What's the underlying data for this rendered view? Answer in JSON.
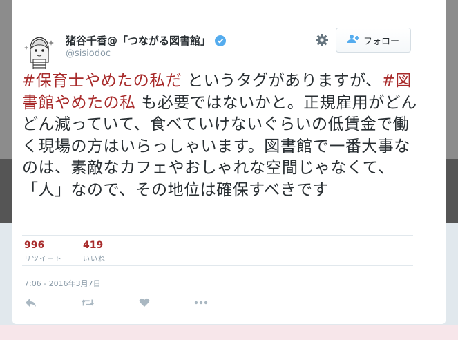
{
  "profile": {
    "display_name": "猪谷千香@「つながる図書館」",
    "handle": "@sisiodoc",
    "verified": true,
    "avatar_icon": "illustrated-avatar"
  },
  "header": {
    "follow_label": "フォロー",
    "follow_icon": "add-user-icon",
    "settings_icon": "gear-icon"
  },
  "tweet": {
    "segments": [
      {
        "text": "#保育士やめたの私だ",
        "hashtag": true
      },
      {
        "text": " というタグがありますが、",
        "hashtag": false
      },
      {
        "text": "#図書館やめたの私",
        "hashtag": true
      },
      {
        "text": " も必要ではないかと。正規雇用がどんどん減っていて、食べていけないぐらいの低賃金で働く現場の方はいらっしゃいます。図書館で一番大事なのは、素敵なカフェやおしゃれな空間じゃなくて、「人」なので、その地位は確保すべきです",
        "hashtag": false
      }
    ]
  },
  "stats": {
    "retweets_count": "996",
    "retweets_label": "リツイート",
    "likes_count": "419",
    "likes_label": "いいね"
  },
  "timestamp": "7:06 - 2016年3月7日",
  "actions": [
    "reply-icon",
    "retweet-icon",
    "like-icon",
    "more-icon"
  ],
  "colors": {
    "hashtag": "#a82b2b",
    "stat_number": "#a82b2b",
    "verified": "#55acee",
    "muted": "#8899a6",
    "text": "#292f33"
  }
}
